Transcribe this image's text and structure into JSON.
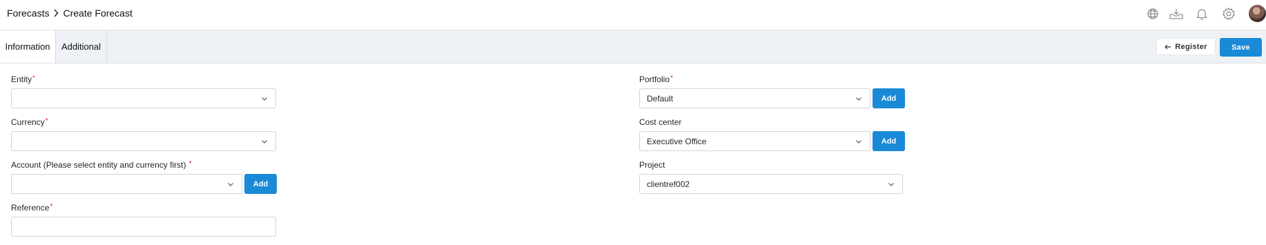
{
  "breadcrumb": {
    "parent": "Forecasts",
    "current": "Create Forecast"
  },
  "header_icons": [
    "globe-icon",
    "inbox-download-icon",
    "bell-icon",
    "gear-icon"
  ],
  "tabs": [
    {
      "label": "Information",
      "active": true
    },
    {
      "label": "Additional",
      "active": false
    }
  ],
  "actions": {
    "register_label": "Register",
    "save_label": "Save"
  },
  "form": {
    "entity": {
      "label": "Entity",
      "required_mark": "*",
      "value": ""
    },
    "currency": {
      "label": "Currency",
      "required_mark": "*",
      "value": ""
    },
    "account": {
      "label": "Account (Please select entity and currency first)",
      "required_mark": "*",
      "value": "",
      "add_label": "Add"
    },
    "reference": {
      "label": "Reference",
      "required_mark": "*",
      "value": ""
    },
    "portfolio": {
      "label": "Portfolio",
      "required_mark": "*",
      "value": "Default",
      "add_label": "Add"
    },
    "cost_center": {
      "label": "Cost center",
      "value": "Executive Office",
      "add_label": "Add"
    },
    "project": {
      "label": "Project",
      "value": "clientref002"
    }
  },
  "colors": {
    "primary": "#1a8ad6",
    "required": "#e02424",
    "tabbar_bg": "#eef1f5"
  }
}
